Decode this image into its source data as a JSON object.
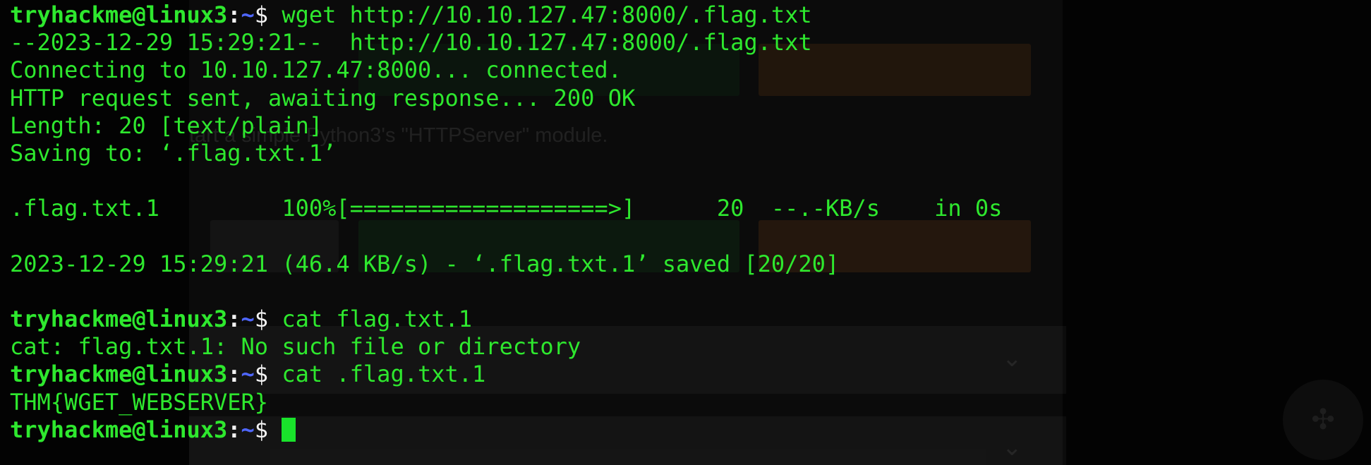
{
  "terminal": {
    "prompt": {
      "user_host": "tryhackme@linux3",
      "sep": ":",
      "path": "~",
      "symbol": "$"
    },
    "lines": [
      {
        "kind": "cmd",
        "text": "wget http://10.10.127.47:8000/.flag.txt"
      },
      {
        "kind": "out",
        "text": "--2023-12-29 15:29:21--  http://10.10.127.47:8000/.flag.txt"
      },
      {
        "kind": "out",
        "text": "Connecting to 10.10.127.47:8000... connected."
      },
      {
        "kind": "out",
        "text": "HTTP request sent, awaiting response... 200 OK"
      },
      {
        "kind": "out",
        "text": "Length: 20 [text/plain]"
      },
      {
        "kind": "out",
        "text": "Saving to: ‘.flag.txt.1’"
      },
      {
        "kind": "blank",
        "text": ""
      },
      {
        "kind": "out",
        "text": ".flag.txt.1         100%[===================>]      20  --.-KB/s    in 0s"
      },
      {
        "kind": "blank",
        "text": ""
      },
      {
        "kind": "out",
        "text": "2023-12-29 15:29:21 (46.4 KB/s) - ‘.flag.txt.1’ saved [20/20]"
      },
      {
        "kind": "blank",
        "text": ""
      },
      {
        "kind": "cmd",
        "text": "cat flag.txt.1"
      },
      {
        "kind": "out",
        "text": "cat: flag.txt.1: No such file or directory"
      },
      {
        "kind": "cmd",
        "text": "cat .flag.txt.1"
      },
      {
        "kind": "out",
        "text": "THM{WGET_WEBSERVER}"
      },
      {
        "kind": "prompt",
        "text": ""
      }
    ]
  },
  "background": {
    "ghost_text": "tart a simple Python3's \"HTTPServer\" module."
  },
  "colors": {
    "terminal_green": "#2ee82e",
    "prompt_path_blue": "#4f67ff",
    "cursor_green": "#19e32b",
    "background": "#030303"
  }
}
